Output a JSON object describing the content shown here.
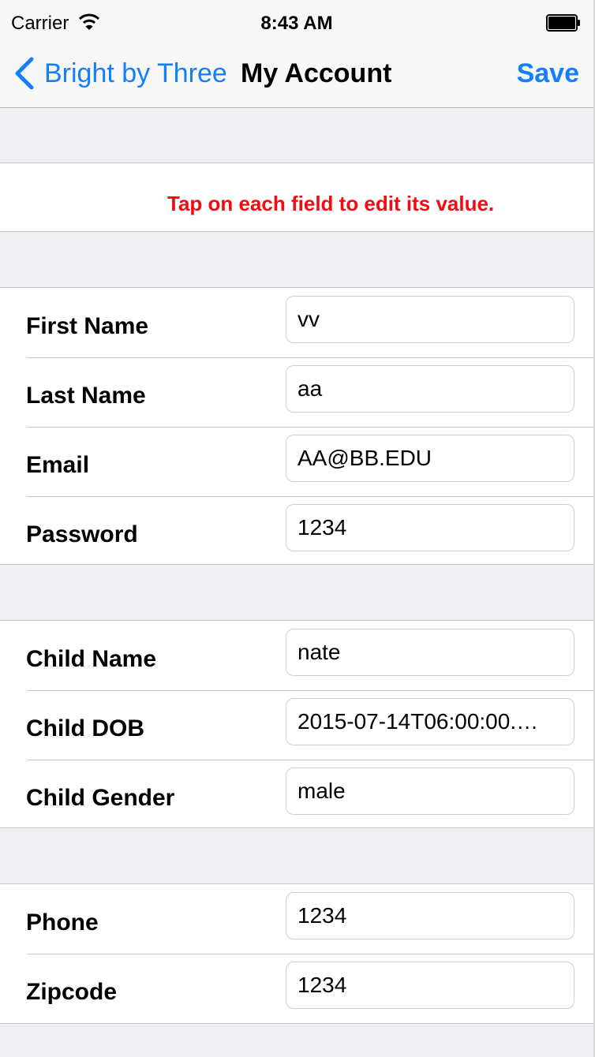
{
  "status_bar": {
    "carrier": "Carrier",
    "time": "8:43 AM"
  },
  "nav": {
    "back_label": "Bright by Three",
    "title": "My Account",
    "save_label": "Save",
    "accent_color": "#157efb"
  },
  "notice": {
    "text": "Tap on each field to edit its value.",
    "color": "#f40b12"
  },
  "account": {
    "first_name": {
      "label": "First Name",
      "value": "vv"
    },
    "last_name": {
      "label": "Last Name",
      "value": "aa"
    },
    "email": {
      "label": "Email",
      "value": "AA@BB.EDU"
    },
    "password": {
      "label": "Password",
      "value": "1234"
    }
  },
  "child": {
    "name": {
      "label": "Child Name",
      "value": "nate"
    },
    "dob": {
      "label": "Child DOB",
      "value": "2015-07-14T06:00:00.…"
    },
    "gender": {
      "label": "Child Gender",
      "value": "male"
    }
  },
  "contact": {
    "phone": {
      "label": "Phone",
      "value": "1234"
    },
    "zipcode": {
      "label": "Zipcode",
      "value": "1234"
    }
  },
  "icons": {
    "wifi": "wifi-icon",
    "battery": "battery-icon",
    "back": "chevron-left-icon"
  }
}
